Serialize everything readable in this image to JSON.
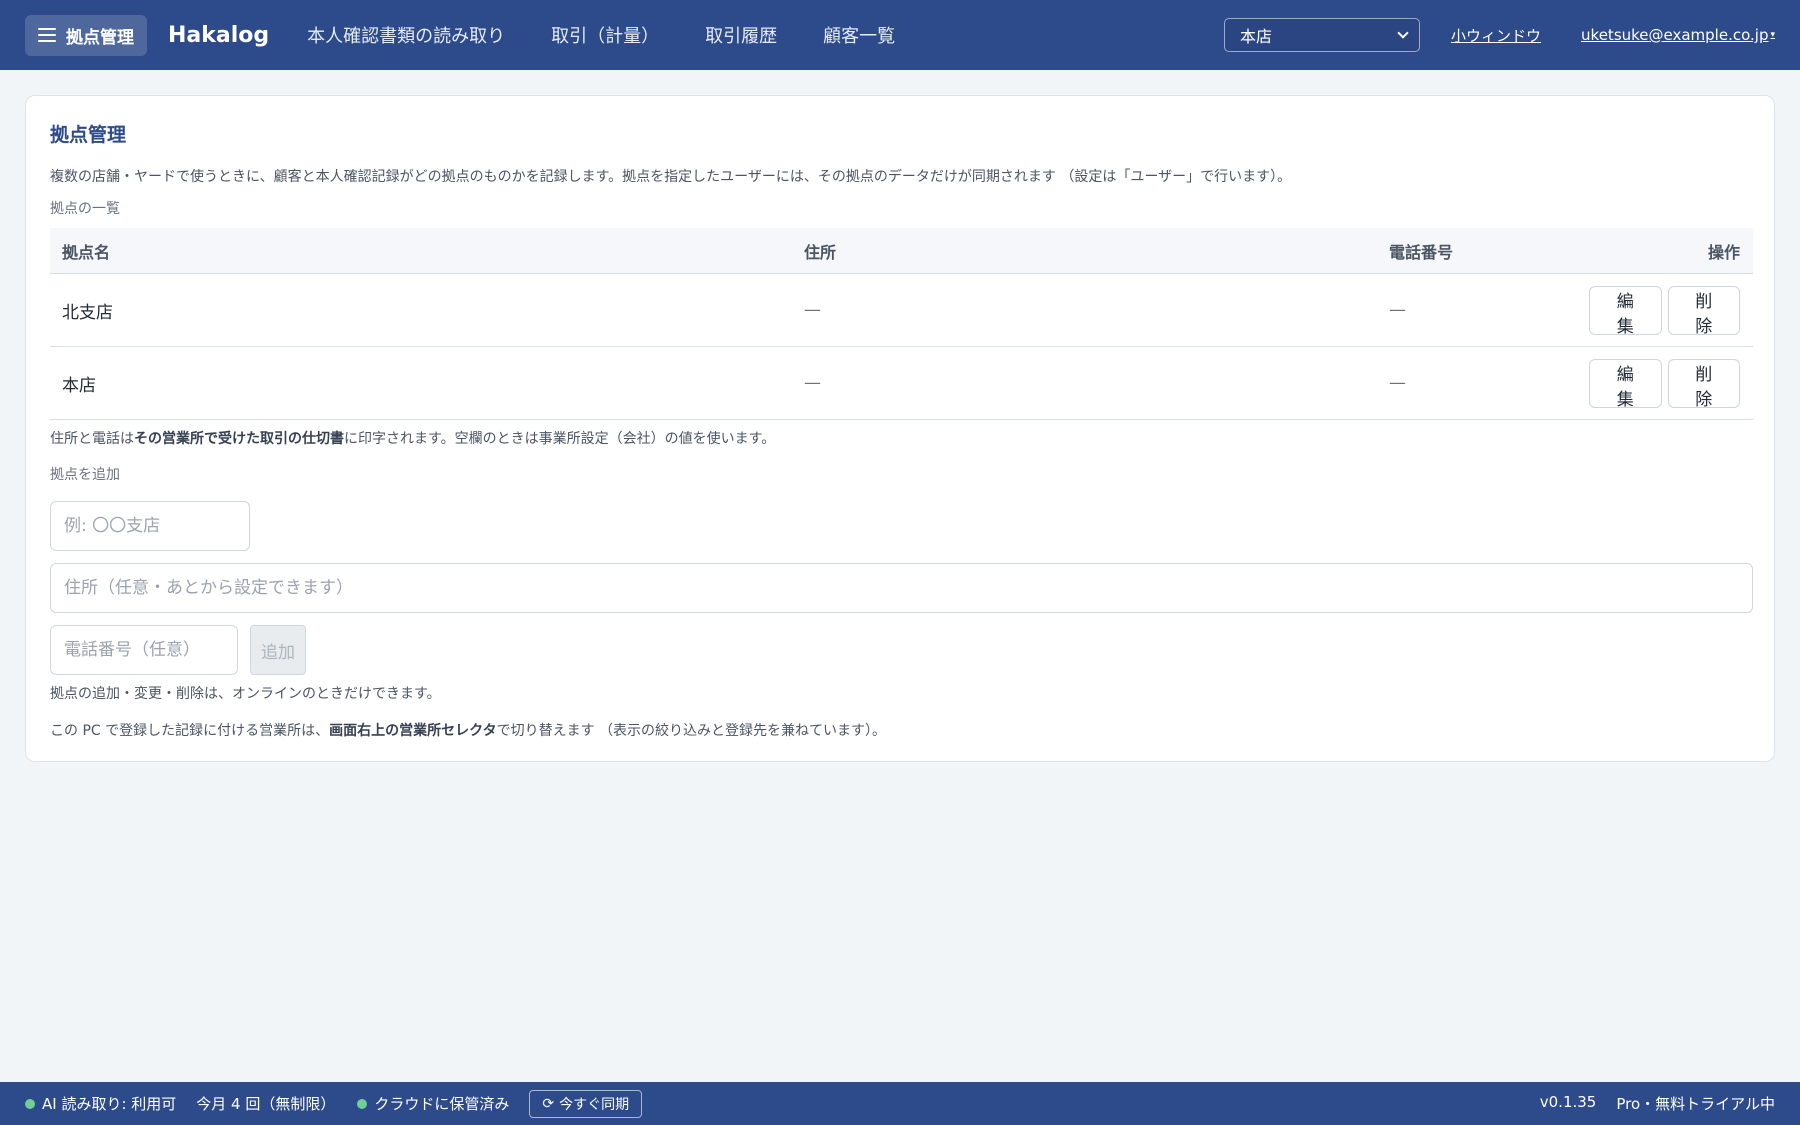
{
  "header": {
    "menu_label": "拠点管理",
    "brand": "Hakalog",
    "nav": [
      "本人確認書類の読み取り",
      "取引（計量）",
      "取引履歴",
      "顧客一覧"
    ],
    "office_selected": "本店",
    "small_window": "小ウィンドウ",
    "user_email": "uketsuke@example.co.jp",
    "user_caret": "▾"
  },
  "card": {
    "title": "拠点管理",
    "description": "複数の店舗・ヤードで使うときに、顧客と本人確認記録がどの拠点のものかを記録します。拠点を指定したユーザーには、その拠点のデータだけが同期されます （設定は「ユーザー」で行います）。",
    "list_label": "拠点の一覧",
    "columns": [
      "拠点名",
      "住所",
      "電話番号",
      "操作"
    ],
    "rows": [
      {
        "name": "北支店",
        "address": "—",
        "phone": "—",
        "edit": "編集",
        "delete": "削除"
      },
      {
        "name": "本店",
        "address": "—",
        "phone": "—",
        "edit": "編集",
        "delete": "削除"
      }
    ],
    "print_note_1": "住所と電話は",
    "print_note_bold": "その営業所で受けた取引の仕切書",
    "print_note_2": "に印字されます。空欄のときは事業所設定（会社）の値を使います。",
    "add_label": "拠点を追加",
    "name_placeholder": "例: 〇〇支店",
    "address_placeholder": "住所（任意・あとから設定できます）",
    "phone_placeholder": "電話番号（任意）",
    "add_button": "追加",
    "online_note": "拠点の追加・変更・削除は、オンラインのときだけできます。",
    "pc_note_1": "この PC で登録した記録に付ける営業所は、",
    "pc_note_bold": "画面右上の営業所セレクタ",
    "pc_note_2": "で切り替えます （表示の絞り込みと登録先を兼ねています）。"
  },
  "status": {
    "ai": "AI 読み取り: 利用可",
    "quota": "今月 4 回（無制限）",
    "cloud": "クラウドに保管済み",
    "sync_icon": "⟳",
    "sync": "今すぐ同期",
    "version": "v0.1.35",
    "plan": "Pro・無料トライアル中"
  }
}
